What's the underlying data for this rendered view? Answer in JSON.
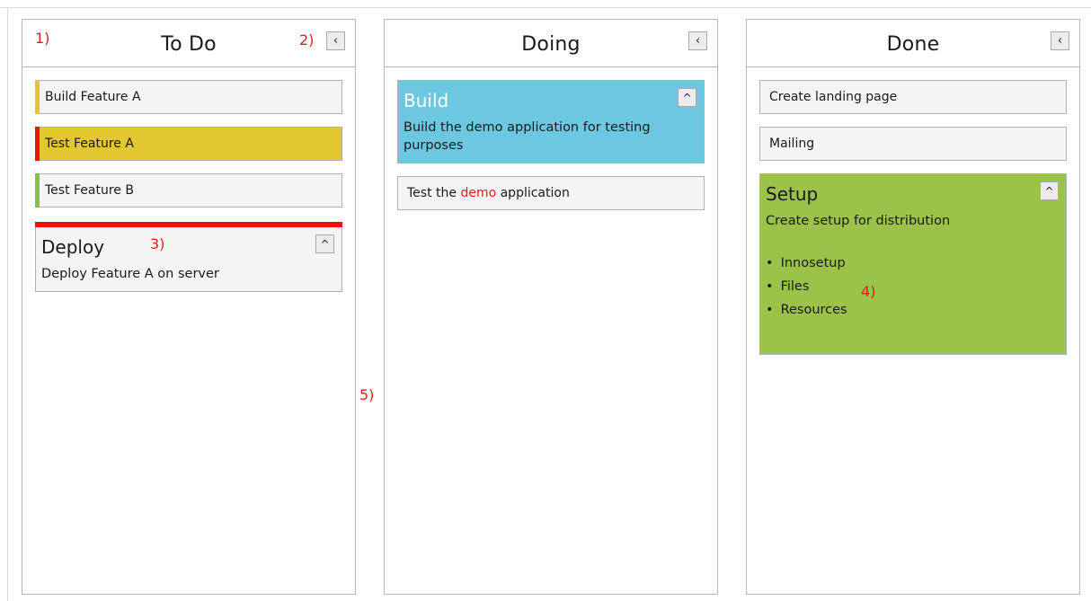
{
  "columns": [
    {
      "title": "To Do",
      "collapse_icon": "chevron-left-icon",
      "cards": [
        {
          "label": "Build Feature A",
          "edge_color": "#e2c731"
        },
        {
          "label": "Test Feature A",
          "edge_color": "#ee1111",
          "bg": "#e2c731"
        },
        {
          "label": "Test Feature B",
          "edge_color": "#8dbd44"
        }
      ],
      "expanded_card": {
        "title": "Deploy",
        "description": "Deploy Feature A on server",
        "top_color": "#ee1111"
      }
    },
    {
      "title": "Doing",
      "collapse_icon": "chevron-left-icon",
      "expanded_card": {
        "title": "Build",
        "description": "Build the demo application for testing purposes",
        "bg": "#6cc8e0"
      },
      "card": {
        "prefix": "Test the ",
        "highlight": "demo",
        "suffix": " application"
      }
    },
    {
      "title": "Done",
      "collapse_icon": "chevron-left-icon",
      "cards": [
        {
          "label": "Create landing page"
        },
        {
          "label": "Mailing"
        }
      ],
      "expanded_card": {
        "title": "Setup",
        "description": "Create setup for distribution",
        "bullets": [
          "Innosetup",
          "Files",
          "Resources"
        ],
        "bg": "#9bc34a"
      }
    }
  ],
  "annotations": {
    "a1": "1)",
    "a2": "2)",
    "a3": "3)",
    "a4": "4)",
    "a5": "5)"
  },
  "icons": {
    "collapse": "‹",
    "expand": "^"
  },
  "colors": {
    "annotation": "#e41b1b",
    "highlight_text": "#e41b1b"
  }
}
